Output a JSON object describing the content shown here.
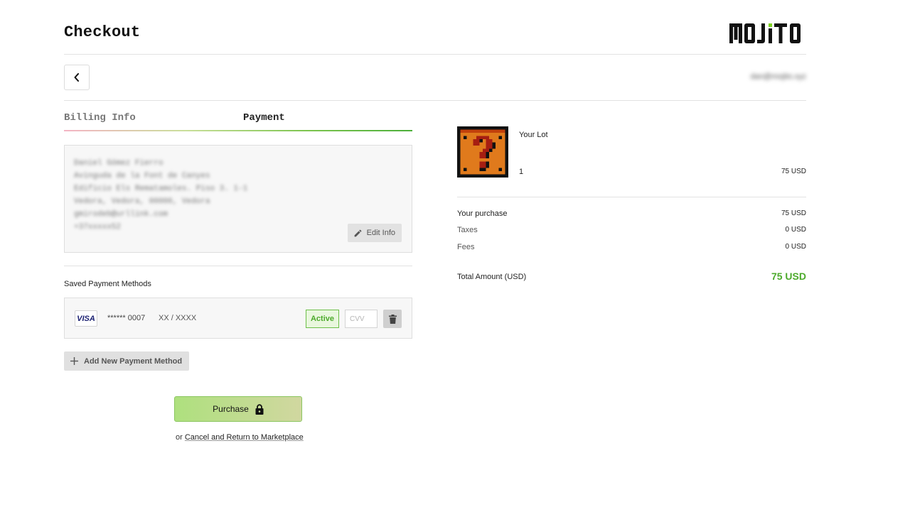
{
  "header": {
    "title": "Checkout",
    "logo_text": "MOJiTO"
  },
  "user": {
    "email": "dan@mojito.xyz"
  },
  "steps": [
    {
      "label": "Billing Info",
      "state": "done"
    },
    {
      "label": "Payment",
      "state": "active"
    }
  ],
  "billing": {
    "lines": [
      "Daniel Gómez Fierro",
      "Avinguda de la Font de Canyes",
      "Edificio Els Rematamoles. Piso 3. 1-1",
      "Vedora, Vedora, 00000, Vedora",
      "gmirodeb@urllink.com",
      "+37xxxxx52"
    ],
    "edit_label": "Edit Info"
  },
  "saved_methods": {
    "section_label": "Saved Payment Methods",
    "card": {
      "brand": "VISA",
      "number": "****** 0007",
      "expiry": "XX / XXXX",
      "status": "Active",
      "cvv_placeholder": "CVV",
      "cvv_value": ""
    },
    "add_label": "Add New Payment Method"
  },
  "actions": {
    "purchase_label": "Purchase",
    "cancel_prefix": "or",
    "cancel_link": "Cancel and Return to Marketplace"
  },
  "summary": {
    "lot_title": "Your Lot",
    "quantity": "1",
    "lot_price": "75 USD",
    "rows": [
      {
        "label": "Your purchase",
        "value": "75 USD"
      },
      {
        "label": "Taxes",
        "value": "0 USD"
      },
      {
        "label": "Fees",
        "value": "0 USD"
      }
    ],
    "total_label": "Total Amount (USD)",
    "total_value": "75 USD"
  },
  "colors": {
    "accent_green": "#4caa2b",
    "lot_orange": "#e07a1c",
    "lot_red": "#a61e12"
  },
  "icons": {
    "back": "chevron-left-icon",
    "edit": "pencil-icon",
    "delete": "trash-icon",
    "add": "plus-icon",
    "purchase": "lock-icon"
  }
}
